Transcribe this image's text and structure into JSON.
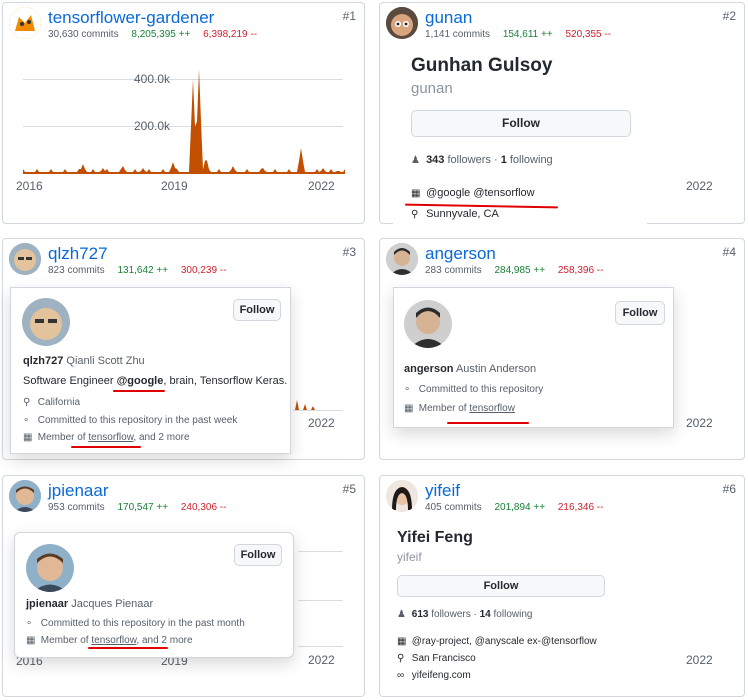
{
  "cards": [
    {
      "rank": "#1",
      "username": "tensorflower-gardener",
      "commits": "30,630 commits",
      "additions": "8,205,395 ++",
      "deletions": "6,398,219 --"
    },
    {
      "rank": "#2",
      "username": "gunan",
      "commits": "1,141 commits",
      "additions": "154,611 ++",
      "deletions": "520,355 --"
    },
    {
      "rank": "#3",
      "username": "qlzh727",
      "commits": "823 commits",
      "additions": "131,642 ++",
      "deletions": "300,239 --"
    },
    {
      "rank": "#4",
      "username": "angerson",
      "commits": "283 commits",
      "additions": "284,985 ++",
      "deletions": "258,396 --"
    },
    {
      "rank": "#5",
      "username": "jpienaar",
      "commits": "953 commits",
      "additions": "170,547 ++",
      "deletions": "240,306 --"
    },
    {
      "rank": "#6",
      "username": "yifeif",
      "commits": "405 commits",
      "additions": "201,894 ++",
      "deletions": "216,346 --"
    }
  ],
  "chart1": {
    "y_ticks": [
      "400.0k",
      "200.0k"
    ],
    "x_ticks": [
      "2016",
      "2019",
      "2022"
    ],
    "bar_color": "#c24e00"
  },
  "year_2022": "2022",
  "year_2019": "2019",
  "year_2016": "2016",
  "popovers": {
    "gunan": {
      "full_name": "Gunhan Gulsoy",
      "login": "gunan",
      "follow": "Follow",
      "followers_count": "343",
      "followers_label": "followers",
      "sep": "·",
      "following_count": "1",
      "following_label": "following",
      "org": "@google @tensorflow",
      "location": "Sunnyvale, CA"
    },
    "qlzh727": {
      "login": "qlzh727",
      "full_name": "Qianli Scott Zhu",
      "follow": "Follow",
      "bio_pre": "Software Engineer ",
      "bio_org": "@google",
      "bio_post": ", brain, Tensorflow Keras.",
      "location": "California",
      "committed": "Committed to this repository in the past week",
      "member_pre": "Member of ",
      "member_org": "tensorflow",
      "member_post": ", and 2 more"
    },
    "angerson": {
      "login": "angerson",
      "full_name": "Austin Anderson",
      "follow": "Follow",
      "committed": "Committed to this repository",
      "member_pre": "Member of ",
      "member_org": "tensorflow"
    },
    "jpienaar": {
      "login": "jpienaar",
      "full_name": "Jacques Pienaar",
      "follow": "Follow",
      "committed": "Committed to this repository in the past month",
      "member_pre": "Member of ",
      "member_org": "tensorflow",
      "member_post": ", and 2 more"
    },
    "yifeif": {
      "full_name": "Yifei Feng",
      "login": "yifeif",
      "follow": "Follow",
      "followers_count": "613",
      "followers_label": "followers",
      "sep": "·",
      "following_count": "14",
      "following_label": "following",
      "org": "@ray-project, @anyscale ex-@tensorflow",
      "location": "San Francisco",
      "website": "yifeifeng.com"
    }
  }
}
